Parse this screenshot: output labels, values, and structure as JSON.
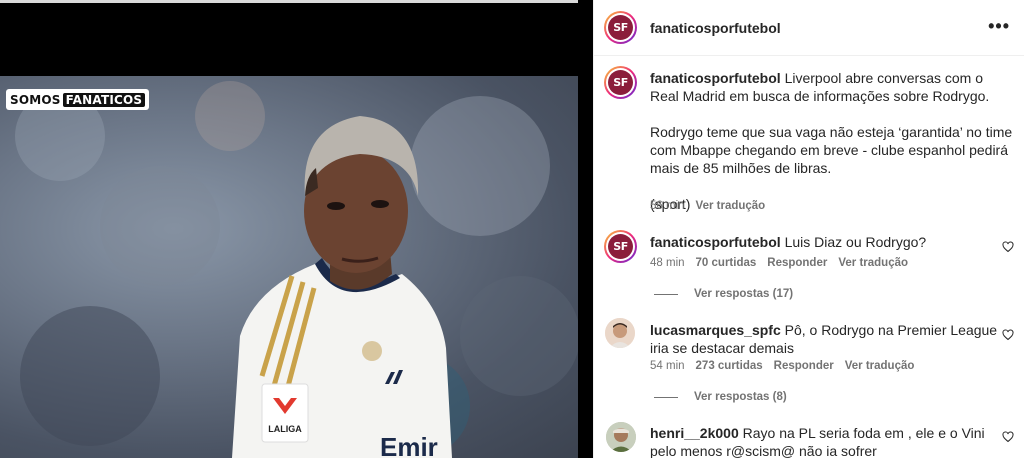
{
  "media": {
    "brand_part1": "SOMOS",
    "brand_part2": "FANATICOS",
    "jersey_badge": "LALIGA",
    "jersey_sponsor": "Emir"
  },
  "post": {
    "avatar_text": "SF",
    "username": "fanaticosporfutebol",
    "more_label": "•••",
    "caption_line1": "Liverpool abre conversas com o Real Madrid em busca de informações sobre Rodrygo.",
    "caption_para2": "Rodrygo teme que sua vaga não esteja ‘garantida’ no time com Mbappe chegando em breve - clube espanhol pedirá mais de 85 milhões de libras.",
    "caption_para3": "(sport)",
    "time": "56 min",
    "translate": "Ver tradução"
  },
  "comments": [
    {
      "username": "fanaticosporfutebol",
      "text": "Luis Diaz ou Rodrygo?",
      "time": "48 min",
      "likes": "70 curtidas",
      "reply": "Responder",
      "translate": "Ver tradução",
      "replies": "Ver respostas (17)"
    },
    {
      "username": "lucasmarques_spfc",
      "text": "Pô, o Rodrygo na Premier League iria se destacar demais",
      "time": "54 min",
      "likes": "273 curtidas",
      "reply": "Responder",
      "translate": "Ver tradução",
      "replies": "Ver respostas (8)"
    },
    {
      "username": "henri__2k000",
      "text": "Rayo na PL seria foda em , ele e o Vini pelo menos r@scism@ não ia sofrer"
    }
  ],
  "icons": {
    "heart": "heart-outline-icon",
    "more": "more-horizontal-icon"
  },
  "colors": {
    "brand": "#8b1d3b",
    "secondary_text": "#737373"
  }
}
